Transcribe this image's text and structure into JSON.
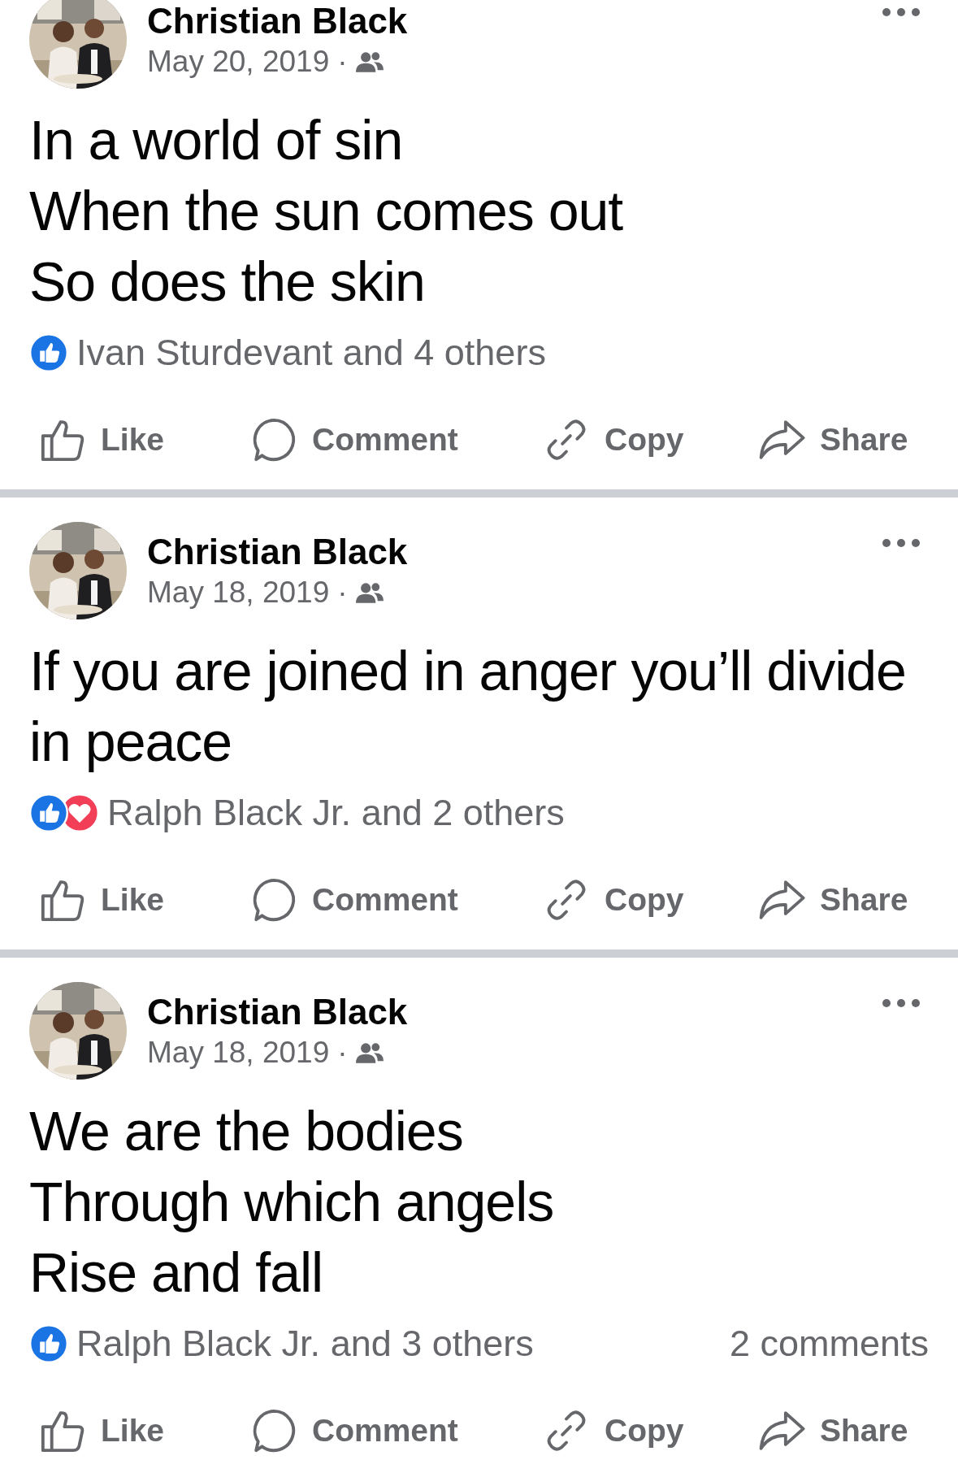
{
  "posts": [
    {
      "author": "Christian Black",
      "date": "May 20, 2019",
      "separator": "·",
      "text_lines": [
        "In a world of sin",
        "When the sun comes out",
        "So does the skin"
      ],
      "reactions": [
        {
          "kind": "like"
        }
      ],
      "reaction_summary": "Ivan Sturdevant and 4 others",
      "actions": [
        {
          "label": "Like",
          "kind": "like"
        },
        {
          "label": "Comment",
          "kind": "comment"
        },
        {
          "label": "Copy",
          "kind": "copy"
        },
        {
          "label": "Share",
          "kind": "share"
        }
      ]
    },
    {
      "author": "Christian Black",
      "date": "May 18, 2019",
      "separator": "·",
      "text_lines": [
        "If you are joined in anger you’ll divide in peace"
      ],
      "reactions": [
        {
          "kind": "like"
        },
        {
          "kind": "love"
        }
      ],
      "reaction_summary": "Ralph Black Jr. and 2 others",
      "actions": [
        {
          "label": "Like",
          "kind": "like"
        },
        {
          "label": "Comment",
          "kind": "comment"
        },
        {
          "label": "Copy",
          "kind": "copy"
        },
        {
          "label": "Share",
          "kind": "share"
        }
      ]
    },
    {
      "author": "Christian Black",
      "date": "May 18, 2019",
      "separator": "·",
      "text_lines": [
        "We are the bodies",
        "Through which angels",
        "Rise and fall"
      ],
      "reactions": [
        {
          "kind": "like"
        }
      ],
      "reaction_summary": "Ralph Black Jr. and 3 others",
      "comments": "2 comments",
      "actions": [
        {
          "label": "Like",
          "kind": "like"
        },
        {
          "label": "Comment",
          "kind": "comment"
        },
        {
          "label": "Copy",
          "kind": "copy"
        },
        {
          "label": "Share",
          "kind": "share"
        }
      ]
    }
  ]
}
